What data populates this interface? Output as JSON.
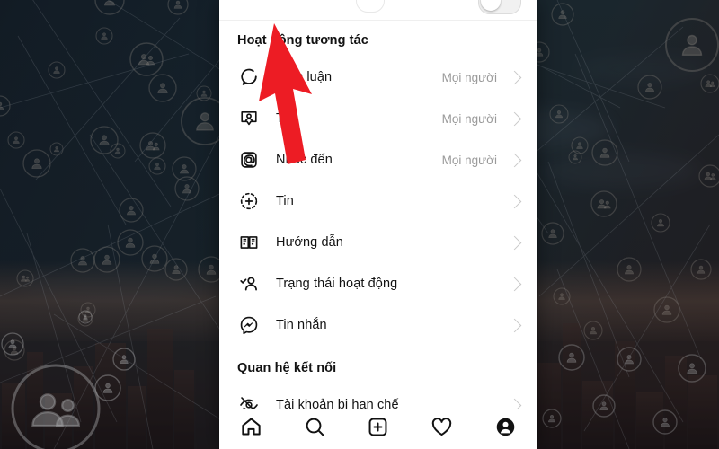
{
  "background": {
    "description": "dark social-network graph over city skyline",
    "base_color": "#1d3039",
    "warm_color": "#2e2525"
  },
  "phone": {
    "top_toggle": {
      "name": "cut-off-toggle",
      "state": "off"
    },
    "sections": [
      {
        "title": "Hoạt động tương tác",
        "rows": [
          {
            "icon": "comment-icon",
            "label": "Bình luận",
            "value": "Mọi người"
          },
          {
            "icon": "tag-icon",
            "label": "Thẻ",
            "value": "Mọi người"
          },
          {
            "icon": "mention-icon",
            "label": "Nhắc đến",
            "value": "Mọi người"
          },
          {
            "icon": "story-icon",
            "label": "Tin",
            "value": ""
          },
          {
            "icon": "guide-book-icon",
            "label": "Hướng dẫn",
            "value": ""
          },
          {
            "icon": "activity-status-icon",
            "label": "Trạng thái hoạt động",
            "value": ""
          },
          {
            "icon": "messenger-icon",
            "label": "Tin nhắn",
            "value": ""
          }
        ]
      },
      {
        "title": "Quan hệ kết nối",
        "rows": [
          {
            "icon": "restricted-eye-icon",
            "label": "Tài khoản bị hạn chế",
            "value": ""
          }
        ]
      }
    ],
    "bottom_nav": [
      {
        "icon": "home-icon",
        "label": "Trang chủ"
      },
      {
        "icon": "search-icon",
        "label": "Tìm kiếm"
      },
      {
        "icon": "add-icon",
        "label": "Tạo"
      },
      {
        "icon": "heart-icon",
        "label": "Hoạt động"
      },
      {
        "icon": "profile-icon",
        "label": "Trang cá nhân"
      }
    ]
  },
  "annotation": {
    "arrow": {
      "name": "red-pointer-arrow",
      "color": "#ED1C24",
      "points_to": "Tin"
    }
  }
}
